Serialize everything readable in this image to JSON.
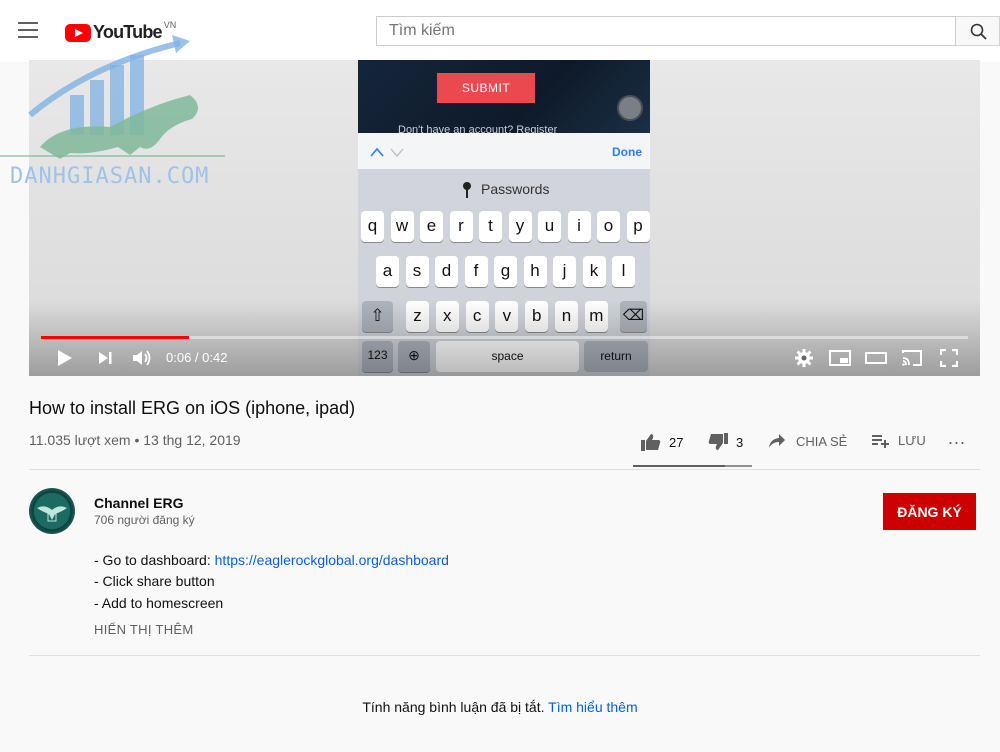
{
  "header": {
    "logo_text": "YouTube",
    "logo_country": "VN",
    "search_placeholder": "Tìm kiếm"
  },
  "player": {
    "time_current": "0:06",
    "time_separator": " / ",
    "time_total": "0:42",
    "progress": 0.16,
    "screen": {
      "submit_label": "SUBMIT",
      "account_text": "Don't have an account? Register",
      "done_label": "Done",
      "passwords_label": "Passwords",
      "row1": [
        "q",
        "w",
        "e",
        "r",
        "t",
        "y",
        "u",
        "i",
        "o",
        "p"
      ],
      "row2": [
        "a",
        "s",
        "d",
        "f",
        "g",
        "h",
        "j",
        "k",
        "l"
      ],
      "row3": [
        "z",
        "x",
        "c",
        "v",
        "b",
        "n",
        "m"
      ],
      "num_label": "123",
      "space_label": "space",
      "return_label": "return"
    }
  },
  "watermark": {
    "text": "DANHGIASAN.COM"
  },
  "video": {
    "title": "How to install ERG on iOS (iphone, ipad)",
    "views": "11.035 lượt xem",
    "separator": " • ",
    "date": "13 thg 12, 2019",
    "likes": "27",
    "dislikes": "3",
    "share_label": "CHIA SẺ",
    "save_label": "LƯU",
    "more_label": "..."
  },
  "channel": {
    "name": "Channel ERG",
    "subscribers": "706 người đăng ký",
    "subscribe_label": "ĐĂNG KÝ"
  },
  "description": {
    "line1_prefix": "- Go to dashboard: ",
    "line1_link": "https://eaglerockglobal.org/dashboard",
    "line2": "- Click share button",
    "line3": "- Add to homescreen",
    "show_more": "HIỂN THỊ THÊM"
  },
  "comments": {
    "disabled_text": "Tính năng bình luận đã bị tắt.",
    "learn_more": "Tìm hiểu thêm"
  },
  "colors": {
    "accent_red": "#ff0000",
    "subscribe_bg": "#cc0000",
    "link": "#065fd4"
  }
}
